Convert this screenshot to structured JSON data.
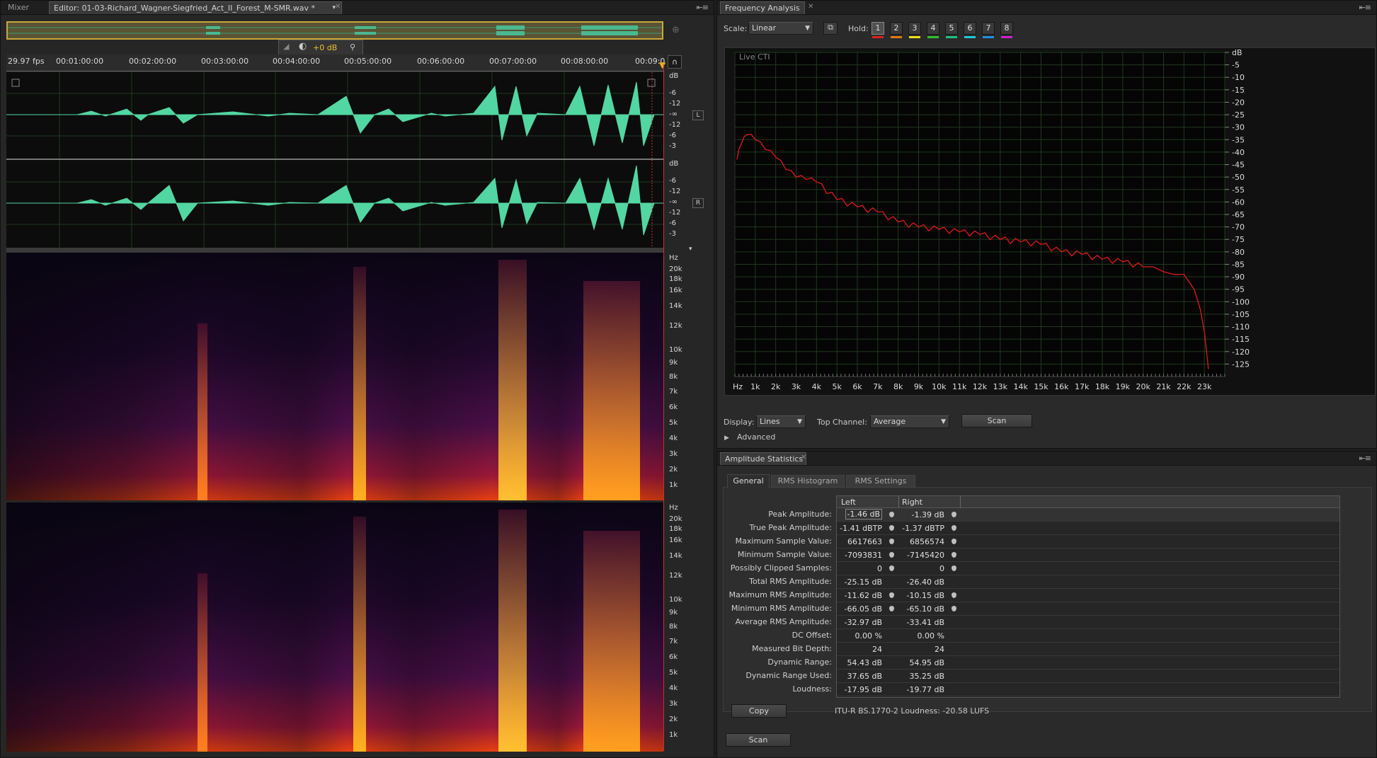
{
  "editor": {
    "tabs": [
      {
        "label": "Mixer"
      },
      {
        "label": "Editor: 01-03-Richard_Wagner-Siegfried_Act_II_Forest_M-SMR.wav *"
      }
    ],
    "gain_label": "+0 dB",
    "fps": "29.97 fps",
    "timeline": [
      "00:01:00:00",
      "00:02:00:00",
      "00:03:00:00",
      "00:04:00:00",
      "00:05:00:00",
      "00:06:00:00",
      "00:07:00:00",
      "00:08:00:00",
      "00:09:0"
    ],
    "channels": [
      {
        "name": "L"
      },
      {
        "name": "R"
      }
    ],
    "db_scale": [
      "dB",
      "-6",
      "-12",
      "-∞",
      "-12",
      "-6",
      "-3"
    ],
    "hz_scale": [
      "Hz",
      "20k",
      "18k",
      "16k",
      "14k",
      "12k",
      "10k",
      "9k",
      "8k",
      "7k",
      "6k",
      "5k",
      "4k",
      "3k",
      "2k",
      "1k"
    ]
  },
  "freq": {
    "tab": "Frequency Analysis",
    "scale_label": "Scale:",
    "scale_value": "Linear",
    "hold_label": "Hold:",
    "holds": [
      {
        "n": "1",
        "color": "#e02020"
      },
      {
        "n": "2",
        "color": "#e07a10"
      },
      {
        "n": "3",
        "color": "#e8e020"
      },
      {
        "n": "4",
        "color": "#30c030"
      },
      {
        "n": "5",
        "color": "#20c080"
      },
      {
        "n": "6",
        "color": "#20c8d8"
      },
      {
        "n": "7",
        "color": "#2090e0"
      },
      {
        "n": "8",
        "color": "#d020d0"
      }
    ],
    "live_label": "Live CTI",
    "display_label": "Display:",
    "display_value": "Lines",
    "top_channel_label": "Top Channel:",
    "top_channel_value": "Average",
    "scan_label": "Scan",
    "advanced_label": "Advanced"
  },
  "chart_data": {
    "type": "line",
    "x_ticks": [
      "Hz",
      "1k",
      "2k",
      "3k",
      "4k",
      "5k",
      "6k",
      "7k",
      "8k",
      "9k",
      "10k",
      "11k",
      "12k",
      "13k",
      "14k",
      "15k",
      "16k",
      "17k",
      "18k",
      "19k",
      "20k",
      "21k",
      "22k",
      "23k"
    ],
    "y_ticks": [
      "dB",
      "-5",
      "-10",
      "-15",
      "-20",
      "-25",
      "-30",
      "-35",
      "-40",
      "-45",
      "-50",
      "-55",
      "-60",
      "-65",
      "-70",
      "-75",
      "-80",
      "-85",
      "-90",
      "-95",
      "-100",
      "-105",
      "-110",
      "-115",
      "-120",
      "-125"
    ],
    "xlim": [
      0,
      24000
    ],
    "ylim": [
      -130,
      0
    ],
    "grid": true,
    "series": [
      {
        "color": "#e01818",
        "x": [
          100,
          300,
          600,
          1000,
          1500,
          2000,
          2500,
          3000,
          3500,
          4000,
          5000,
          6000,
          7000,
          8000,
          9000,
          10000,
          11000,
          12000,
          13000,
          14000,
          15000,
          16000,
          17000,
          18000,
          19000,
          20000,
          20500,
          21000,
          21500,
          22000,
          22500,
          22800,
          23000,
          23200
        ],
        "y": [
          -43,
          -37,
          -33,
          -35,
          -39,
          -42,
          -47,
          -50,
          -51,
          -52,
          -59,
          -62,
          -64,
          -68,
          -70,
          -71,
          -72,
          -73,
          -75,
          -76,
          -77,
          -80,
          -81,
          -83,
          -84,
          -86,
          -86,
          -88,
          -89,
          -89,
          -95,
          -103,
          -112,
          -127
        ]
      }
    ]
  },
  "stats": {
    "tab": "Amplitude Statistics",
    "subtabs": [
      {
        "label": "General"
      },
      {
        "label": "RMS Histogram"
      },
      {
        "label": "RMS Settings"
      }
    ],
    "col_left": "Left",
    "col_right": "Right",
    "rows": [
      {
        "label": "Peak Amplitude:",
        "left": "-1.46 dB",
        "right": "-1.39 dB",
        "pin": true
      },
      {
        "label": "True Peak Amplitude:",
        "left": "-1.41 dBTP",
        "right": "-1.37 dBTP",
        "pin": true
      },
      {
        "label": "Maximum Sample Value:",
        "left": "6617663",
        "right": "6856574",
        "pin": true
      },
      {
        "label": "Minimum Sample Value:",
        "left": "-7093831",
        "right": "-7145420",
        "pin": true
      },
      {
        "label": "Possibly Clipped Samples:",
        "left": "0",
        "right": "0",
        "pin": true
      },
      {
        "label": "Total RMS Amplitude:",
        "left": "-25.15 dB",
        "right": "-26.40 dB",
        "pin": false
      },
      {
        "label": "Maximum RMS Amplitude:",
        "left": "-11.62 dB",
        "right": "-10.15 dB",
        "pin": true
      },
      {
        "label": "Minimum RMS Amplitude:",
        "left": "-66.05 dB",
        "right": "-65.10 dB",
        "pin": true
      },
      {
        "label": "Average RMS Amplitude:",
        "left": "-32.97 dB",
        "right": "-33.41 dB",
        "pin": false
      },
      {
        "label": "DC Offset:",
        "left": "0.00 %",
        "right": "0.00 %",
        "pin": false
      },
      {
        "label": "Measured Bit Depth:",
        "left": "24",
        "right": "24",
        "pin": false
      },
      {
        "label": "Dynamic Range:",
        "left": "54.43 dB",
        "right": "54.95 dB",
        "pin": false
      },
      {
        "label": "Dynamic Range Used:",
        "left": "37.65 dB",
        "right": "35.25 dB",
        "pin": false
      },
      {
        "label": "Loudness:",
        "left": "-17.95 dB",
        "right": "-19.77 dB",
        "pin": false
      }
    ],
    "copy_label": "Copy",
    "itu_text": "ITU-R BS.1770-2 Loudness: -20.58 LUFS",
    "scan_label": "Scan"
  }
}
